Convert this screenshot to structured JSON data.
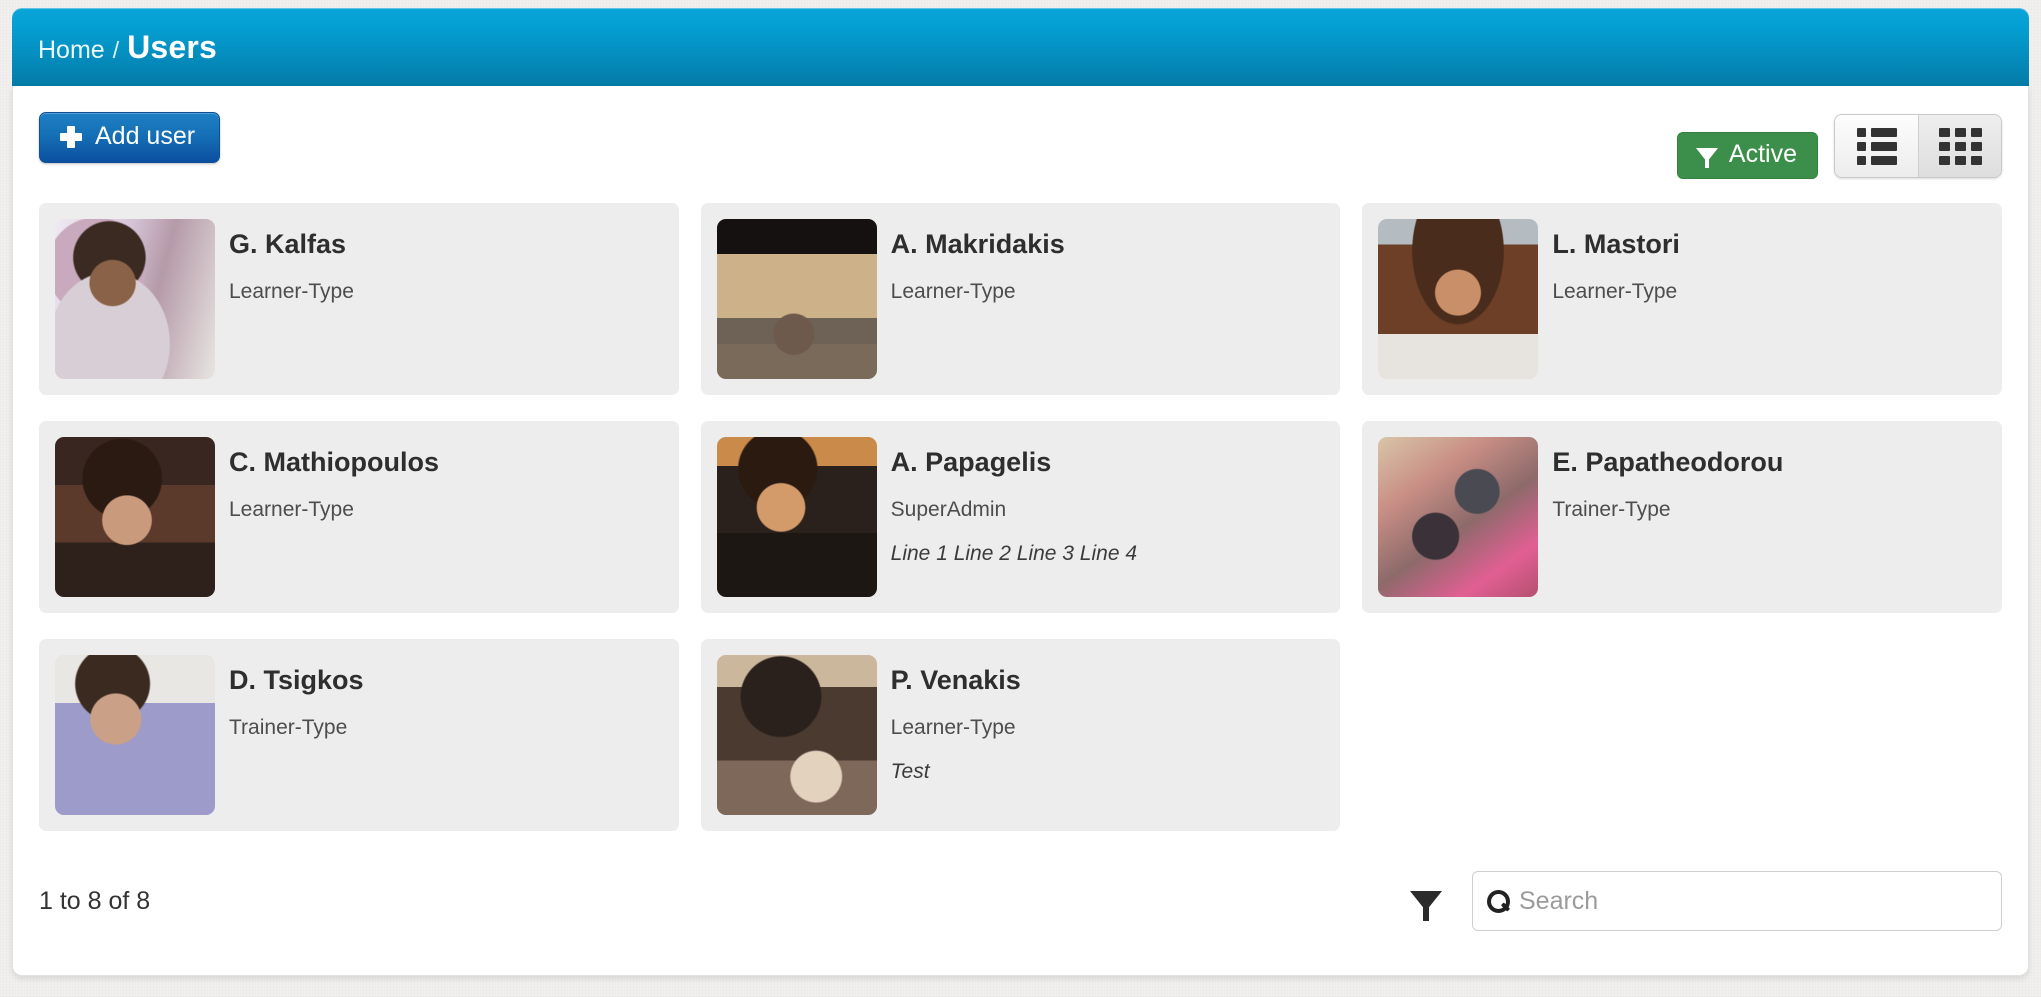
{
  "header": {
    "breadcrumb_home": "Home",
    "breadcrumb_separator": "/",
    "breadcrumb_current": "Users",
    "brand_color": "#0a9fd3"
  },
  "toolbar": {
    "add_user_label": "Add user",
    "filter_active_label": "Active",
    "filter_active_color": "#3c8f4b",
    "add_button_color": "#1570b6",
    "view_list_label": "List view",
    "view_grid_label": "Grid view",
    "active_view": "grid"
  },
  "users": [
    {
      "name": "G. Kalfas",
      "role": "Learner-Type",
      "extra": "",
      "photo": "ph1"
    },
    {
      "name": "A. Makridakis",
      "role": "Learner-Type",
      "extra": "",
      "photo": "ph2"
    },
    {
      "name": "L. Mastori",
      "role": "Learner-Type",
      "extra": "",
      "photo": "ph3"
    },
    {
      "name": "C. Mathiopoulos",
      "role": "Learner-Type",
      "extra": "",
      "photo": "ph4"
    },
    {
      "name": "A. Papagelis",
      "role": "SuperAdmin",
      "extra": "Line 1 Line 2 Line 3 Line 4",
      "photo": "ph5"
    },
    {
      "name": "E. Papatheodorou",
      "role": "Trainer-Type",
      "extra": "",
      "photo": "ph6"
    },
    {
      "name": "D. Tsigkos",
      "role": "Trainer-Type",
      "extra": "",
      "photo": "ph7"
    },
    {
      "name": "P. Venakis",
      "role": "Learner-Type",
      "extra": "Test",
      "photo": "ph8"
    }
  ],
  "footer": {
    "pager_info": "1 to 8 of 8",
    "search_placeholder": "Search",
    "search_value": ""
  }
}
